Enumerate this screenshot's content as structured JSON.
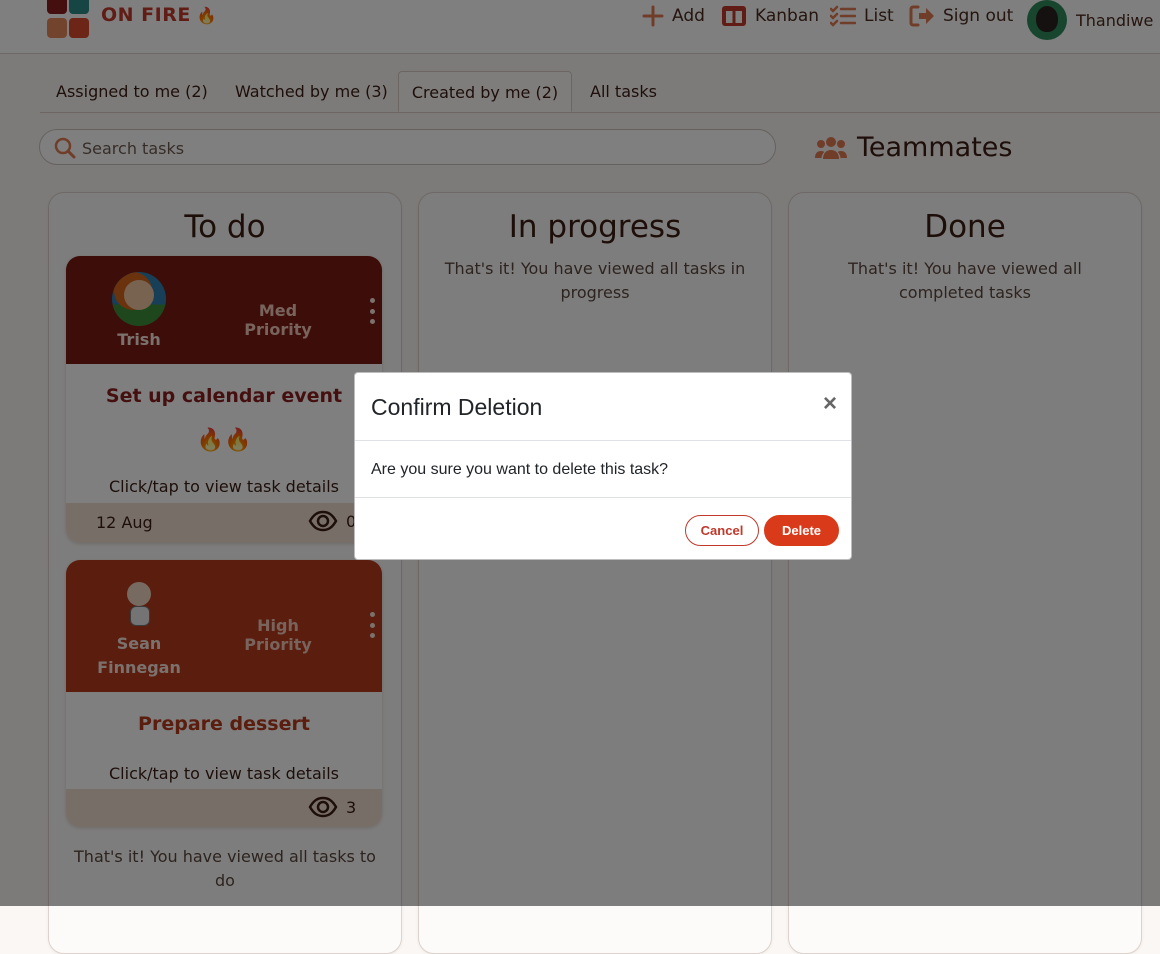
{
  "brand": {
    "name": "ON FIRE",
    "flame": "🔥"
  },
  "nav": {
    "add": "Add",
    "kanban": "Kanban",
    "list": "List",
    "signout": "Sign out",
    "user": "Thandiwe"
  },
  "tabs": [
    {
      "label": "Assigned to me (2)"
    },
    {
      "label": "Watched by me (3)"
    },
    {
      "label": "Created by me (2)",
      "active": true
    },
    {
      "label": "All tasks"
    }
  ],
  "search": {
    "placeholder": "Search tasks",
    "value": ""
  },
  "teammates": {
    "label": "Teammates"
  },
  "columns": {
    "todo": {
      "title": "To do",
      "empty": "That's it! You have viewed all tasks to do",
      "cards": [
        {
          "owner": "Trish",
          "priority": "Med Priority",
          "title": "Set up calendar event",
          "fire": "🔥🔥",
          "details": "Click/tap to view task details",
          "date": "12 Aug",
          "watchers": "0"
        },
        {
          "owner": "Sean Finnegan",
          "priority": "High Priority",
          "title": "Prepare dessert",
          "details": "Click/tap to view task details",
          "date": "",
          "watchers": "3"
        }
      ]
    },
    "progress": {
      "title": "In progress",
      "empty": "That's it! You have viewed all tasks in progress"
    },
    "done": {
      "title": "Done",
      "empty": "That's it! You have viewed all completed tasks"
    }
  },
  "modal": {
    "title": "Confirm Deletion",
    "close": "×",
    "body": "Are you sure you want to delete this task?",
    "cancel": "Cancel",
    "delete": "Delete"
  },
  "colors": {
    "accent": "#c0392b",
    "card_med": "#7a1a14",
    "card_high": "#b53a1c",
    "delete_button": "#d93a1a"
  },
  "icons": {
    "add": "plus-icon",
    "kanban": "columns-icon",
    "list": "checklist-icon",
    "signout": "sign-out-icon",
    "search": "search-icon",
    "teammates": "users-icon",
    "watch": "eye-icon",
    "menu": "kebab-menu-icon",
    "close": "close-icon"
  }
}
